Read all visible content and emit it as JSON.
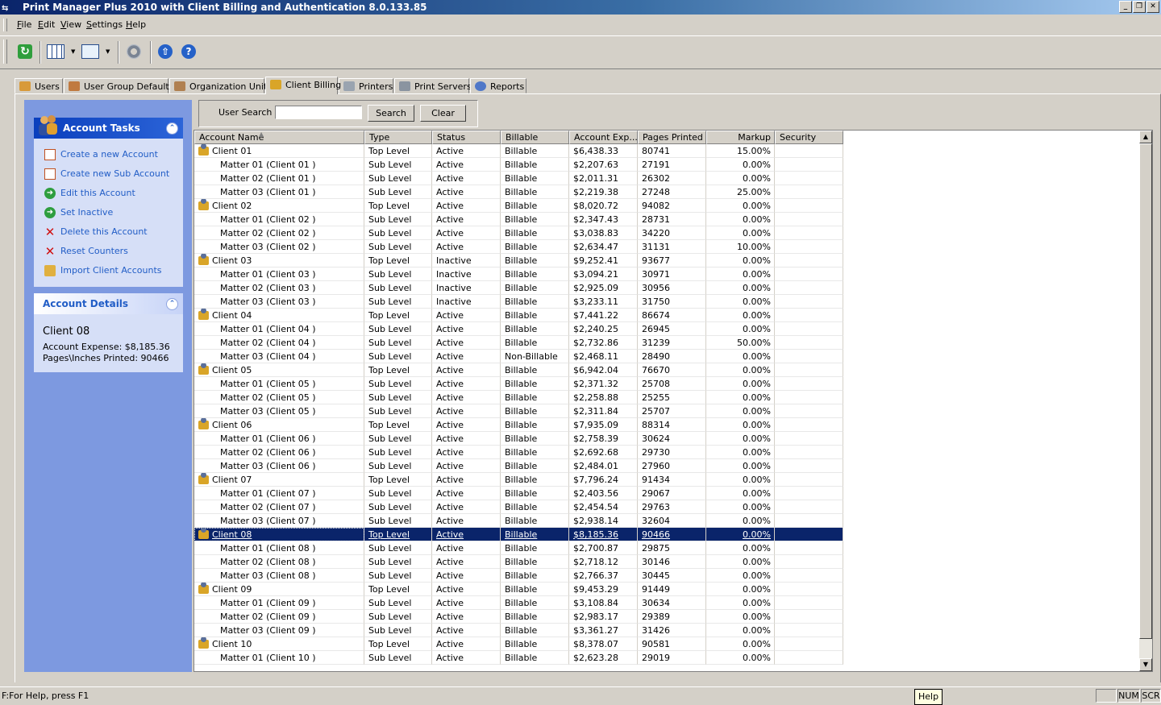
{
  "window": {
    "title": "Print Manager Plus 2010 with Client Billing and Authentication 8.0.133.85",
    "controls": [
      "_",
      "❐",
      "✕"
    ]
  },
  "menu": [
    {
      "hot": "F",
      "rest": "ile"
    },
    {
      "hot": "E",
      "rest": "dit"
    },
    {
      "hot": "V",
      "rest": "iew"
    },
    {
      "hot": "S",
      "rest": "ettings"
    },
    {
      "hot": "H",
      "rest": "elp"
    }
  ],
  "toolbar": {
    "icons": [
      "refresh-icon",
      "grid-view-icon",
      "chart-view-icon",
      "settings-gear-icon",
      "update-icon",
      "help-icon"
    ]
  },
  "tabs": [
    "Users",
    "User Group Defaults",
    "Organization Units",
    "Client Billing",
    "Printers",
    "Print Servers",
    "Reports"
  ],
  "account_tasks": {
    "title": "Account Tasks",
    "items": [
      "Create a new Account",
      "Create new Sub Account",
      "Edit this Account",
      "Set Inactive",
      "Delete this Account",
      "Reset Counters",
      "Import Client Accounts"
    ]
  },
  "account_details": {
    "title": "Account Details",
    "name": "Client 08",
    "expense": "Account Expense: $8,185.36",
    "pages": "Pages\\Inches Printed: 90466"
  },
  "search": {
    "label": "User Search",
    "value": "",
    "search_button": "Search",
    "clear_button": "Clear"
  },
  "table": {
    "columns": [
      "Account Name",
      "Type",
      "Status",
      "Billable",
      "Account Exp...",
      "Pages Printed",
      "Markup",
      "Security"
    ],
    "sort_indicator": "▲",
    "selected_row": 28,
    "rows": [
      [
        "Client 01",
        "Top Level",
        "Active",
        "Billable",
        "$6,438.33",
        "80741",
        "15.00%",
        ""
      ],
      [
        "Matter 01 (Client 01 )",
        "Sub Level",
        "Active",
        "Billable",
        "$2,207.63",
        "27191",
        "0.00%",
        ""
      ],
      [
        "Matter 02 (Client 01 )",
        "Sub Level",
        "Active",
        "Billable",
        "$2,011.31",
        "26302",
        "0.00%",
        ""
      ],
      [
        "Matter 03 (Client 01 )",
        "Sub Level",
        "Active",
        "Billable",
        "$2,219.38",
        "27248",
        "25.00%",
        ""
      ],
      [
        "Client 02",
        "Top Level",
        "Active",
        "Billable",
        "$8,020.72",
        "94082",
        "0.00%",
        ""
      ],
      [
        "Matter 01 (Client 02 )",
        "Sub Level",
        "Active",
        "Billable",
        "$2,347.43",
        "28731",
        "0.00%",
        ""
      ],
      [
        "Matter 02 (Client 02 )",
        "Sub Level",
        "Active",
        "Billable",
        "$3,038.83",
        "34220",
        "0.00%",
        ""
      ],
      [
        "Matter 03 (Client 02 )",
        "Sub Level",
        "Active",
        "Billable",
        "$2,634.47",
        "31131",
        "10.00%",
        ""
      ],
      [
        "Client 03",
        "Top Level",
        "Inactive",
        "Billable",
        "$9,252.41",
        "93677",
        "0.00%",
        ""
      ],
      [
        "Matter 01 (Client 03 )",
        "Sub Level",
        "Inactive",
        "Billable",
        "$3,094.21",
        "30971",
        "0.00%",
        ""
      ],
      [
        "Matter 02 (Client 03 )",
        "Sub Level",
        "Inactive",
        "Billable",
        "$2,925.09",
        "30956",
        "0.00%",
        ""
      ],
      [
        "Matter 03 (Client 03 )",
        "Sub Level",
        "Inactive",
        "Billable",
        "$3,233.11",
        "31750",
        "0.00%",
        ""
      ],
      [
        "Client 04",
        "Top Level",
        "Active",
        "Billable",
        "$7,441.22",
        "86674",
        "0.00%",
        ""
      ],
      [
        "Matter 01 (Client 04 )",
        "Sub Level",
        "Active",
        "Billable",
        "$2,240.25",
        "26945",
        "0.00%",
        ""
      ],
      [
        "Matter 02 (Client 04 )",
        "Sub Level",
        "Active",
        "Billable",
        "$2,732.86",
        "31239",
        "50.00%",
        ""
      ],
      [
        "Matter 03 (Client 04 )",
        "Sub Level",
        "Active",
        "Non-Billable",
        "$2,468.11",
        "28490",
        "0.00%",
        ""
      ],
      [
        "Client 05",
        "Top Level",
        "Active",
        "Billable",
        "$6,942.04",
        "76670",
        "0.00%",
        ""
      ],
      [
        "Matter 01 (Client 05 )",
        "Sub Level",
        "Active",
        "Billable",
        "$2,371.32",
        "25708",
        "0.00%",
        ""
      ],
      [
        "Matter 02 (Client 05 )",
        "Sub Level",
        "Active",
        "Billable",
        "$2,258.88",
        "25255",
        "0.00%",
        ""
      ],
      [
        "Matter 03 (Client 05 )",
        "Sub Level",
        "Active",
        "Billable",
        "$2,311.84",
        "25707",
        "0.00%",
        ""
      ],
      [
        "Client 06",
        "Top Level",
        "Active",
        "Billable",
        "$7,935.09",
        "88314",
        "0.00%",
        ""
      ],
      [
        "Matter 01 (Client 06 )",
        "Sub Level",
        "Active",
        "Billable",
        "$2,758.39",
        "30624",
        "0.00%",
        ""
      ],
      [
        "Matter 02 (Client 06 )",
        "Sub Level",
        "Active",
        "Billable",
        "$2,692.68",
        "29730",
        "0.00%",
        ""
      ],
      [
        "Matter 03 (Client 06 )",
        "Sub Level",
        "Active",
        "Billable",
        "$2,484.01",
        "27960",
        "0.00%",
        ""
      ],
      [
        "Client 07",
        "Top Level",
        "Active",
        "Billable",
        "$7,796.24",
        "91434",
        "0.00%",
        ""
      ],
      [
        "Matter 01 (Client 07 )",
        "Sub Level",
        "Active",
        "Billable",
        "$2,403.56",
        "29067",
        "0.00%",
        ""
      ],
      [
        "Matter 02 (Client 07 )",
        "Sub Level",
        "Active",
        "Billable",
        "$2,454.54",
        "29763",
        "0.00%",
        ""
      ],
      [
        "Matter 03 (Client 07 )",
        "Sub Level",
        "Active",
        "Billable",
        "$2,938.14",
        "32604",
        "0.00%",
        ""
      ],
      [
        "Client 08",
        "Top Level",
        "Active",
        "Billable",
        "$8,185.36",
        "90466",
        "0.00%",
        ""
      ],
      [
        "Matter 01 (Client 08 )",
        "Sub Level",
        "Active",
        "Billable",
        "$2,700.87",
        "29875",
        "0.00%",
        ""
      ],
      [
        "Matter 02 (Client 08 )",
        "Sub Level",
        "Active",
        "Billable",
        "$2,718.12",
        "30146",
        "0.00%",
        ""
      ],
      [
        "Matter 03 (Client 08 )",
        "Sub Level",
        "Active",
        "Billable",
        "$2,766.37",
        "30445",
        "0.00%",
        ""
      ],
      [
        "Client 09",
        "Top Level",
        "Active",
        "Billable",
        "$9,453.29",
        "91449",
        "0.00%",
        ""
      ],
      [
        "Matter 01 (Client 09 )",
        "Sub Level",
        "Active",
        "Billable",
        "$3,108.84",
        "30634",
        "0.00%",
        ""
      ],
      [
        "Matter 02 (Client 09 )",
        "Sub Level",
        "Active",
        "Billable",
        "$2,983.17",
        "29389",
        "0.00%",
        ""
      ],
      [
        "Matter 03 (Client 09 )",
        "Sub Level",
        "Active",
        "Billable",
        "$3,361.27",
        "31426",
        "0.00%",
        ""
      ],
      [
        "Client 10",
        "Top Level",
        "Active",
        "Billable",
        "$8,378.07",
        "90581",
        "0.00%",
        ""
      ],
      [
        "Matter 01 (Client 10 )",
        "Sub Level",
        "Active",
        "Billable",
        "$2,623.28",
        "29019",
        "0.00%",
        ""
      ]
    ]
  },
  "statusbar": {
    "text": "F:For Help, press F1",
    "tooltip": "Help",
    "panels": [
      "",
      "NUM",
      "SCR"
    ]
  }
}
